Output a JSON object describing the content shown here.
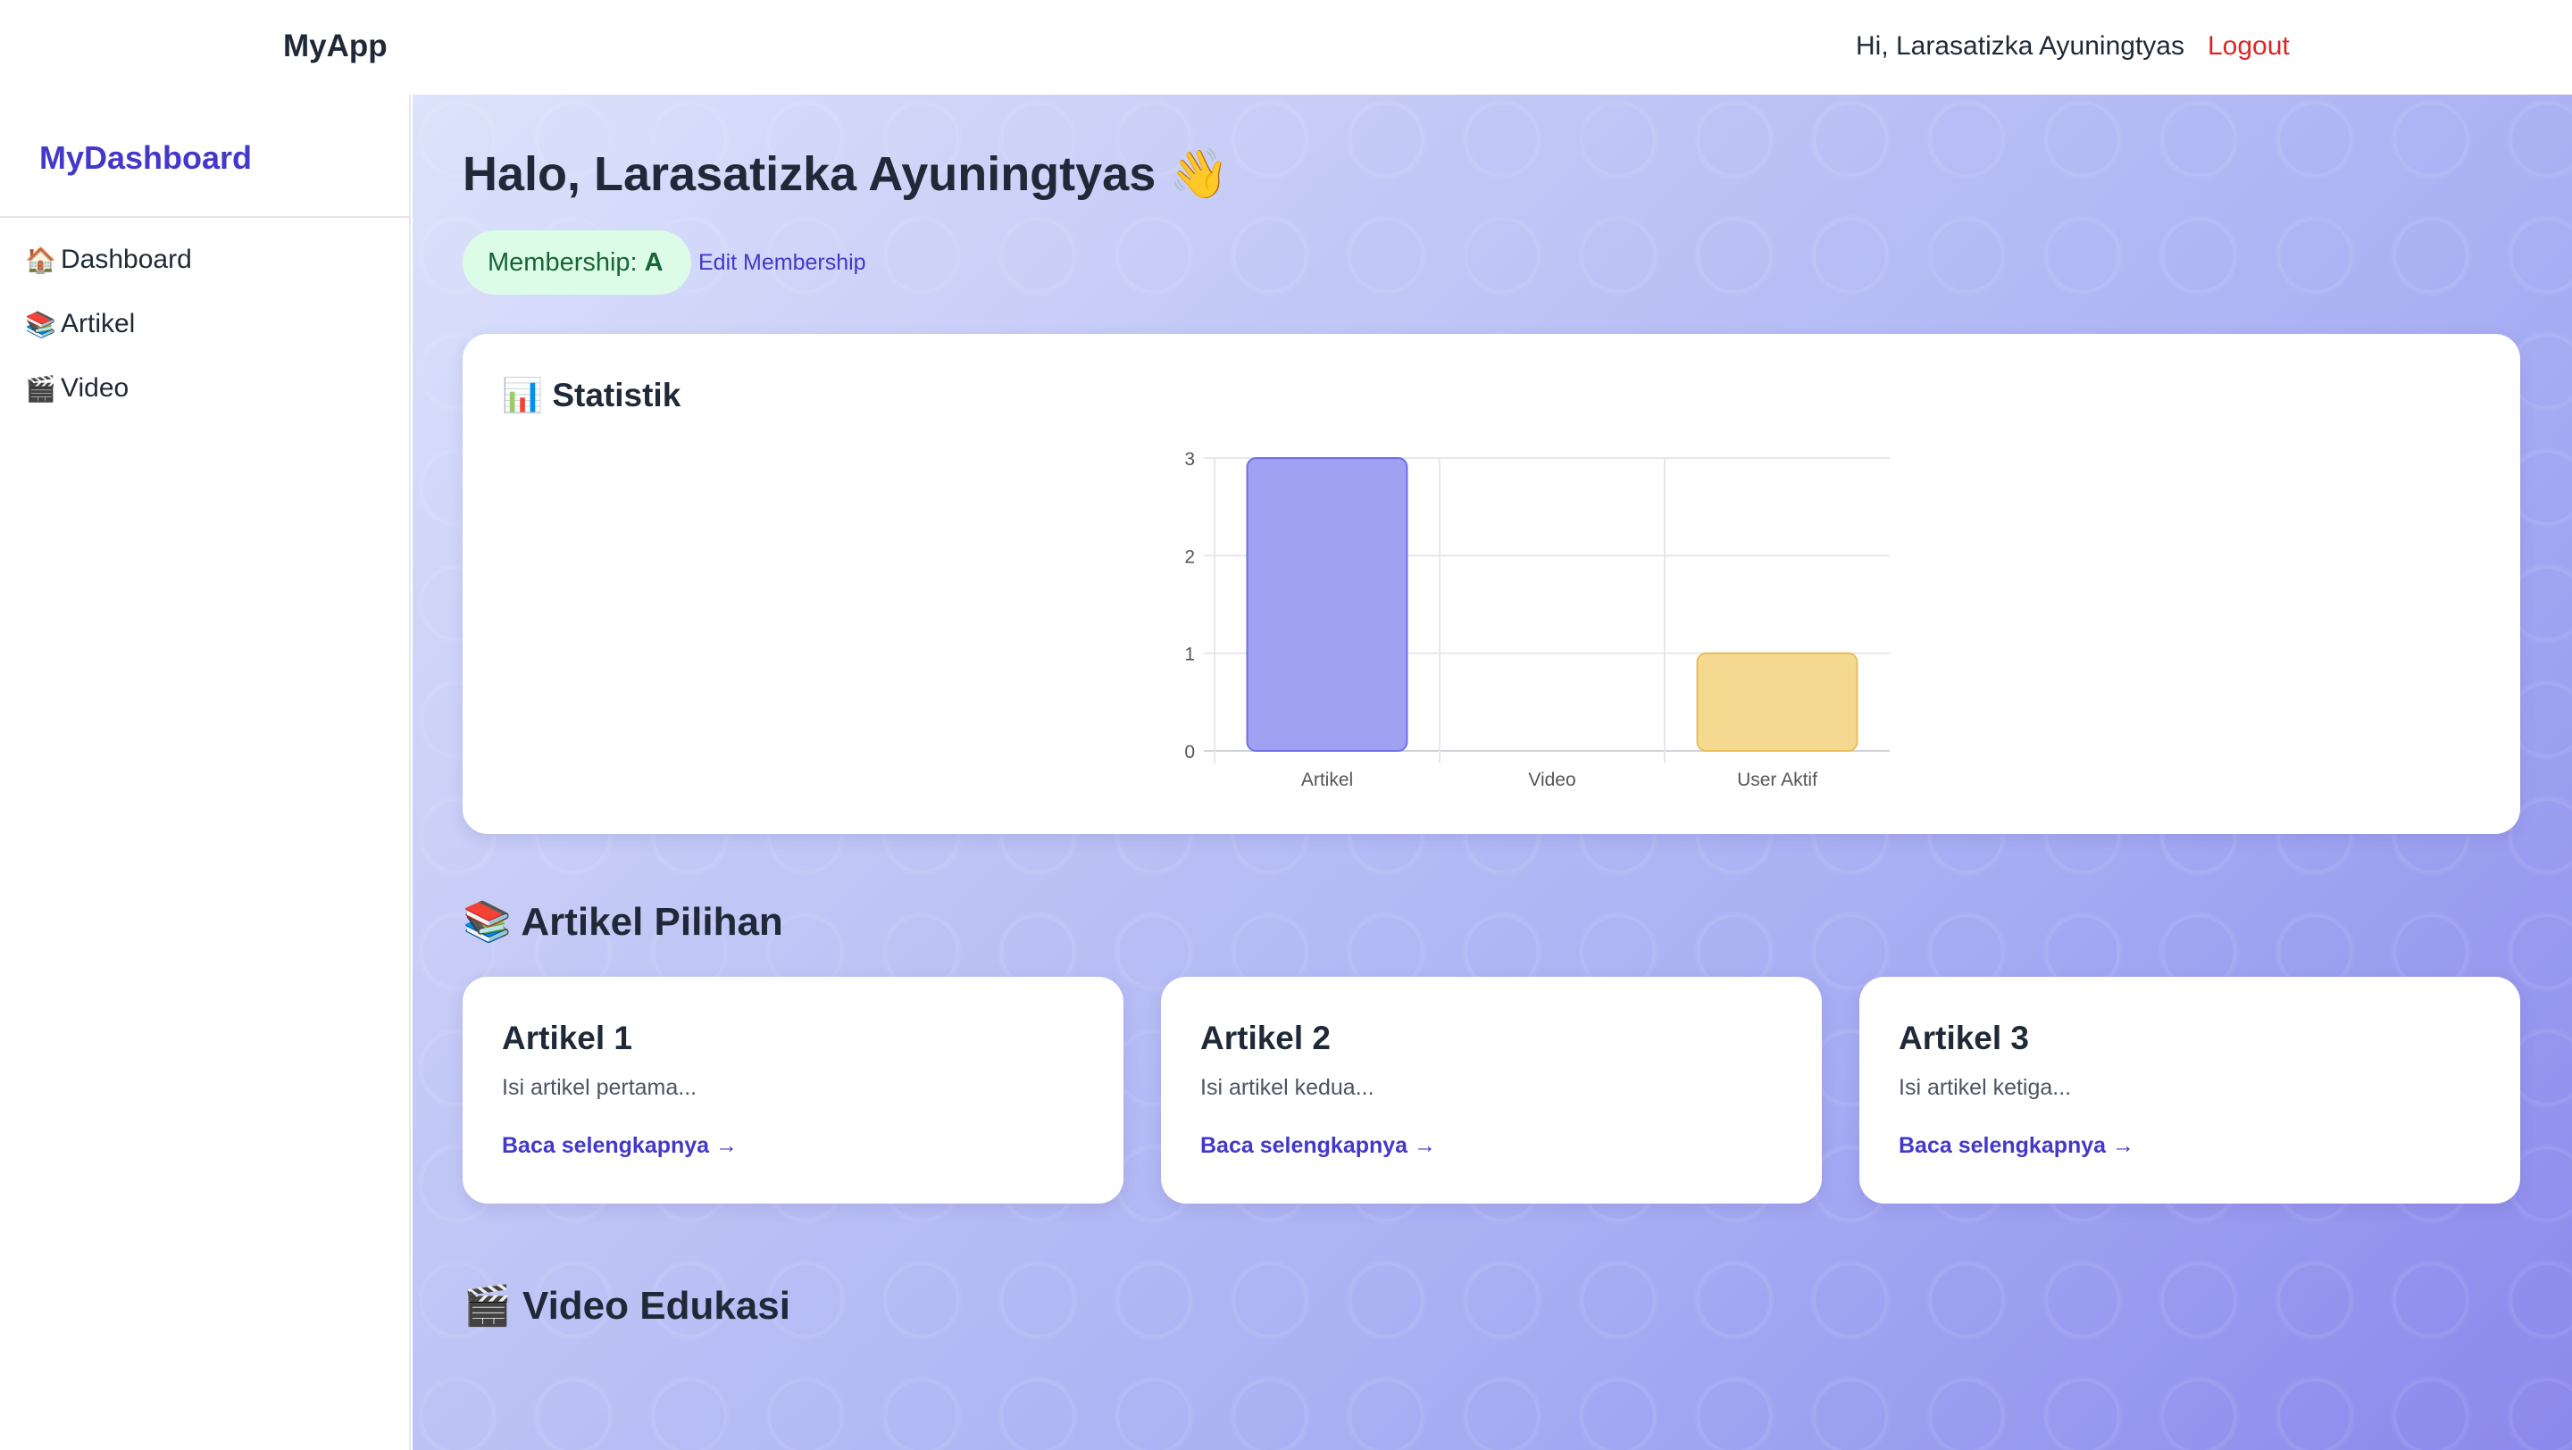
{
  "topbar": {
    "brand": "MyApp",
    "greeting": "Hi, Larasatizka Ayuningtyas",
    "logout_label": "Logout"
  },
  "sidebar": {
    "brand": "MyDashboard",
    "items": [
      {
        "icon": "🏠",
        "icon_name": "house-icon",
        "label": "Dashboard"
      },
      {
        "icon": "📚",
        "icon_name": "books-icon",
        "label": "Artikel"
      },
      {
        "icon": "🎬",
        "icon_name": "clapper-icon",
        "label": "Video"
      }
    ]
  },
  "main": {
    "hello": "Halo, Larasatizka Ayuningtyas 👋",
    "membership": {
      "label": "Membership:",
      "level": "A"
    },
    "edit_membership_label": "Edit Membership",
    "stats_title": "📊 Statistik",
    "articles_title": "📚 Artikel Pilihan",
    "articles": [
      {
        "title": "Artikel 1",
        "excerpt": "Isi artikel pertama...",
        "link": "Baca selengkapnya →"
      },
      {
        "title": "Artikel 2",
        "excerpt": "Isi artikel kedua...",
        "link": "Baca selengkapnya →"
      },
      {
        "title": "Artikel 3",
        "excerpt": "Isi artikel ketiga...",
        "link": "Baca selengkapnya →"
      }
    ],
    "videos_title": "🎬 Video Edukasi"
  },
  "colors": {
    "accent": "#4338ca",
    "logout": "#dc2626",
    "membership_bg": "#dcfce7",
    "membership_text": "#166534"
  },
  "chart_data": {
    "type": "bar",
    "categories": [
      "Artikel",
      "Video",
      "User Aktif"
    ],
    "values": [
      3,
      0,
      1
    ],
    "ylim": [
      0,
      3
    ],
    "yticks": [
      0,
      1,
      2,
      3
    ],
    "bar_colors": [
      "#a1a1f4",
      "#93c5fd",
      "#f6d990"
    ],
    "bar_borders": [
      "#6f6fe6",
      "#60a5fa",
      "#e8bd55"
    ],
    "grid": true,
    "legend": "none"
  }
}
